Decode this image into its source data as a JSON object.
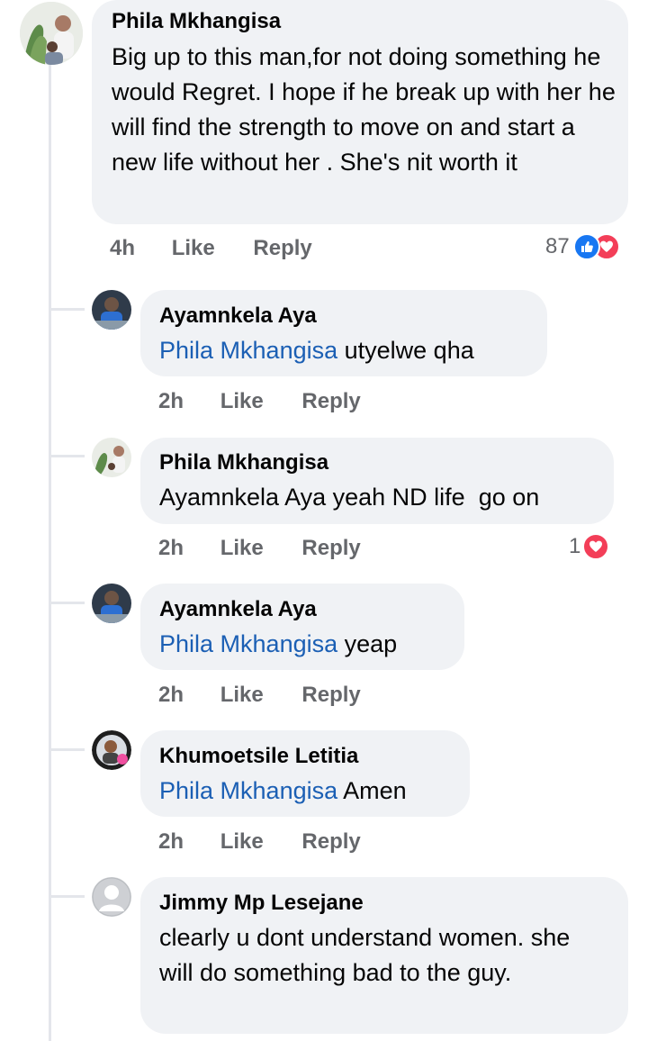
{
  "comment": {
    "author": "Phila Mkhangisa",
    "text": "Big up to this man,for not doing something he would Regret. I hope if he break up with her he will find the strength to move on and start a new life without her . She's nit worth it",
    "time": "4h",
    "like_label": "Like",
    "reply_label": "Reply",
    "reaction_count": "87"
  },
  "replies": [
    {
      "author": "Ayamnkela Aya",
      "mention": "Phila Mkhangisa",
      "text": " utyelwe qha",
      "time": "2h",
      "like_label": "Like",
      "reply_label": "Reply"
    },
    {
      "author": "Phila Mkhangisa",
      "mention": "",
      "text": "Ayamnkela Aya yeah ND life  go on",
      "time": "2h",
      "like_label": "Like",
      "reply_label": "Reply",
      "reaction_count": "1"
    },
    {
      "author": "Ayamnkela Aya",
      "mention": "Phila Mkhangisa",
      "text": " yeap",
      "time": "2h",
      "like_label": "Like",
      "reply_label": "Reply"
    },
    {
      "author": "Khumoetsile Letitia",
      "mention": "Phila Mkhangisa",
      "text": " Amen",
      "time": "2h",
      "like_label": "Like",
      "reply_label": "Reply"
    },
    {
      "author": "Jimmy Mp Lesejane",
      "mention": "",
      "text": "clearly u dont understand women. she will do something bad to the guy.",
      "time": "",
      "like_label": "",
      "reply_label": ""
    }
  ],
  "colors": {
    "like_blue": "#1877f2",
    "love_red": "#f33e58",
    "mention_blue": "#1b5fb4",
    "bubble_bg": "#f0f2f5"
  }
}
